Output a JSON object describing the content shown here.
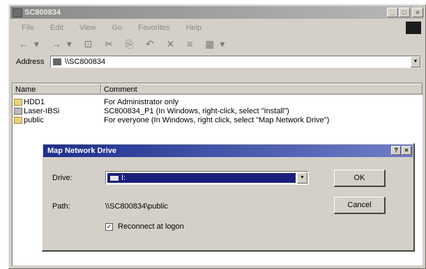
{
  "window": {
    "title": "SC800834",
    "controls": {
      "minimize": "_",
      "maximize": "□",
      "close": "×"
    }
  },
  "menu": [
    "File",
    "Edit",
    "View",
    "Go",
    "Favorites",
    "Help"
  ],
  "toolbar": {
    "icons": [
      "back-icon",
      "forward-icon",
      "up-icon",
      "cut-icon",
      "copy-icon",
      "paste-icon",
      "undo-icon",
      "delete-icon",
      "properties-icon",
      "views-icon"
    ],
    "glyphs": [
      "← ▾",
      "→ ▾",
      "⊡",
      "✂",
      "⎘",
      "📋",
      "↶",
      "✕",
      "≡",
      "▦ ▾"
    ]
  },
  "address": {
    "label": "Address",
    "value": "\\\\SC800834"
  },
  "list": {
    "columns": [
      "Name",
      "Comment"
    ],
    "rows": [
      {
        "name": "HDD1",
        "comment": "For Administrator only",
        "icon": "folder-icon"
      },
      {
        "name": "Laser-IBSi",
        "comment": "SC800834_P1 (In Windows, right-click, select \"Install\")",
        "icon": "printer-icon"
      },
      {
        "name": "public",
        "comment": "For everyone (In Windows, right click, select \"Map Network Drive\")",
        "icon": "folder-icon"
      }
    ]
  },
  "dialog": {
    "title": "Map Network Drive",
    "help_glyph": "?",
    "close_glyph": "×",
    "drive_label": "Drive:",
    "drive_value": "I:",
    "path_label": "Path:",
    "path_value": "\\\\SC800834\\public",
    "ok_label": "OK",
    "cancel_label": "Cancel",
    "reconnect_label": "Reconnect at logon",
    "reconnect_checked": true
  }
}
